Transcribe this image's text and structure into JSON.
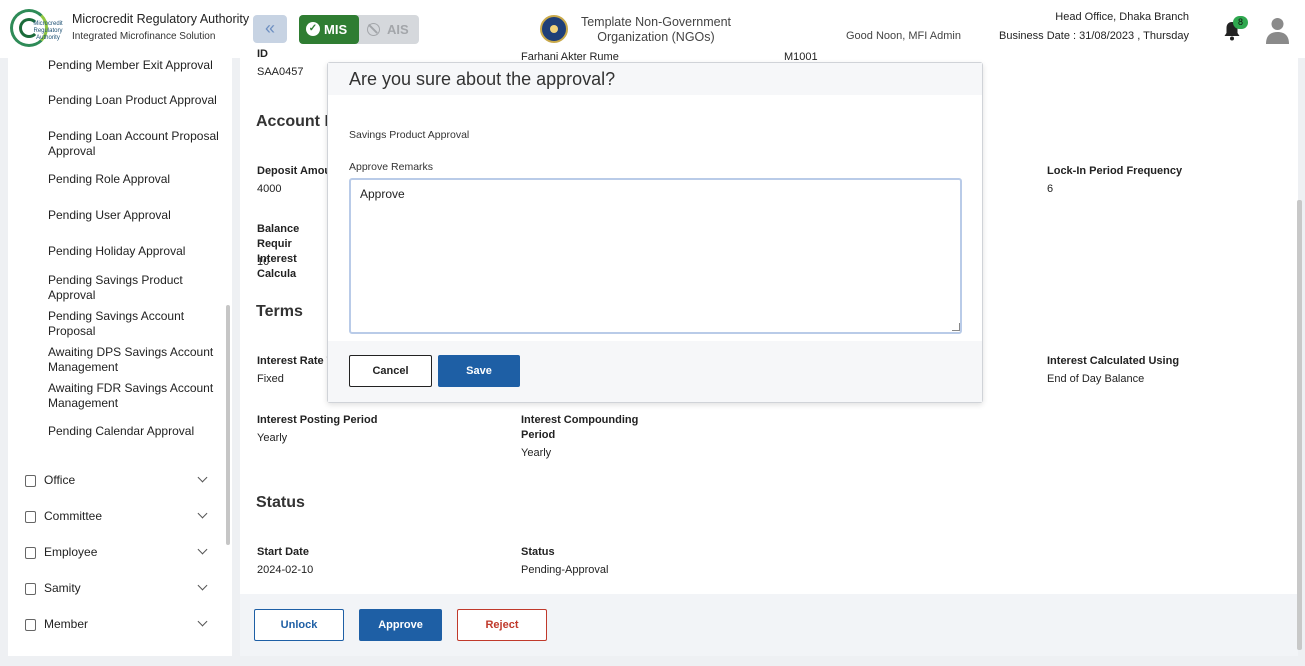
{
  "app": {
    "title": "Microcredit Regulatory Authority",
    "subtitle": "Integrated Microfinance Solution",
    "logo_text": "Microcredit Regulatory Authority"
  },
  "header": {
    "mode_mis": "MIS",
    "mode_ais": "AIS",
    "org_name": "Template Non-Government Organization (NGOs)",
    "greeting": "Good Noon, MFI Admin",
    "branch": "Head Office, Dhaka Branch",
    "business_date": "Business Date : 31/08/2023 , Thursday",
    "notification_count": "8",
    "colors": {
      "mis_active": "#2f7d32",
      "accent": "#1e5fa5"
    },
    "icons": [
      "double-chevron-left-icon",
      "check-circle-icon",
      "ban-icon",
      "bell-icon",
      "user-avatar-icon"
    ]
  },
  "sidebar": {
    "sub_items": [
      {
        "label": "Pending Member Exit Approval"
      },
      {
        "label": "Pending Loan Product Approval"
      },
      {
        "label": "Pending Loan Account Proposal Approval"
      },
      {
        "label": "Pending Role Approval"
      },
      {
        "label": "Pending User Approval"
      },
      {
        "label": "Pending Holiday Approval"
      },
      {
        "label": "Pending Savings Product Approval"
      },
      {
        "label": "Pending Savings Account Proposal"
      },
      {
        "label": "Awaiting DPS Savings Account Management"
      },
      {
        "label": "Awaiting FDR Savings Account Management"
      },
      {
        "label": "Pending Calendar Approval"
      }
    ],
    "sections": [
      {
        "label": "Office"
      },
      {
        "label": "Committee"
      },
      {
        "label": "Employee"
      },
      {
        "label": "Samity"
      },
      {
        "label": "Member"
      }
    ]
  },
  "main": {
    "top": {
      "id_label": "ID",
      "id_value": "SAA0457",
      "name_value": "Farhani Akter Rume",
      "code_value": "M1001"
    },
    "account_info_title": "Account In",
    "deposit_label": "Deposit Amour",
    "deposit_value": "4000",
    "balance_label": "Balance Requir Interest Calcula",
    "balance_value": "10",
    "lockin_label": "Lock-In Period Frequency",
    "lockin_value": "6",
    "terms_title": "Terms",
    "rate_type_label": "Interest Rate T",
    "rate_type_value": "Fixed",
    "calc_using_label": "Interest Calculated Using",
    "calc_using_value": "End of Day Balance",
    "posting_label": "Interest Posting Period",
    "posting_value": "Yearly",
    "compounding_label": "Interest Compounding Period",
    "compounding_value": "Yearly",
    "status_title": "Status",
    "start_date_label": "Start Date",
    "start_date_value": "2024-02-10",
    "status_label": "Status",
    "status_value": "Pending-Approval"
  },
  "actions": {
    "unlock": "Unlock",
    "approve": "Approve",
    "reject": "Reject"
  },
  "modal": {
    "title": "Are you sure about the approval?",
    "subtitle": "Savings Product Approval",
    "remarks_label": "Approve Remarks",
    "remarks_value": "Approve",
    "cancel": "Cancel",
    "save": "Save"
  }
}
